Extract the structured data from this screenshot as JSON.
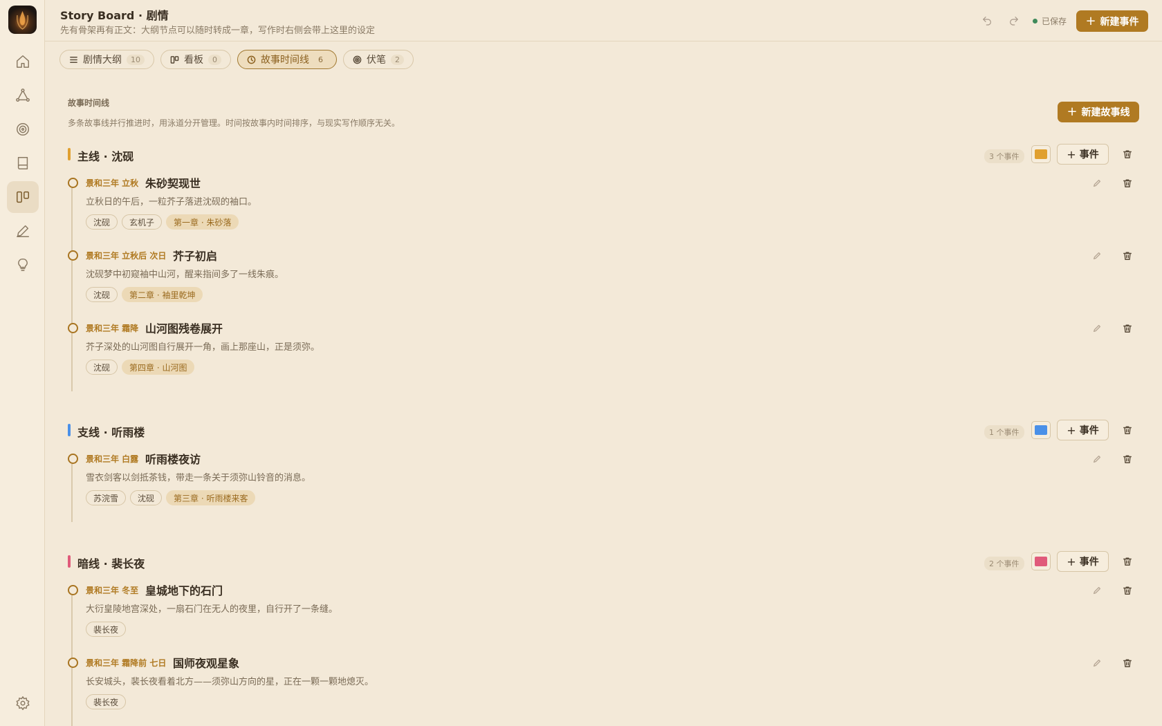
{
  "header": {
    "title": "Story Board · 剧情",
    "subtitle": "先有骨架再有正文：大纲节点可以随时转成一章，写作时右侧会带上这里的设定",
    "save_status": "已保存",
    "new_event_label": "新建事件"
  },
  "sidebar": {
    "items": [
      {
        "name": "home-icon"
      },
      {
        "name": "graph-icon"
      },
      {
        "name": "target-icon"
      },
      {
        "name": "book-icon"
      },
      {
        "name": "board-icon",
        "active": true
      },
      {
        "name": "pen-icon"
      },
      {
        "name": "bulb-icon"
      }
    ]
  },
  "tabs": [
    {
      "label": "剧情大纲",
      "count": "10"
    },
    {
      "label": "看板",
      "count": "0"
    },
    {
      "label": "故事时间线",
      "count": "6",
      "active": true
    },
    {
      "label": "伏笔",
      "count": "2"
    }
  ],
  "section": {
    "label": "故事时间线",
    "desc": "多条故事线并行推进时，用泳道分开管理。时间按故事内时间排序，与现实写作顺序无关。",
    "new_storyline_label": "新建故事线"
  },
  "lanes": [
    {
      "title": "主线 · 沈砚",
      "count": "3 个事件",
      "color": "#e0a030",
      "add_label": "事件",
      "events": [
        {
          "date": "景和三年 立秋",
          "title": "朱砂契现世",
          "desc": "立秋日的午后，一粒芥子落进沈砚的袖口。",
          "tags": [
            "沈砚",
            "玄机子"
          ],
          "chapter": "第一章 · 朱砂落"
        },
        {
          "date": "景和三年 立秋后 次日",
          "title": "芥子初启",
          "desc": "沈砚梦中初窥袖中山河，醒来指间多了一线朱痕。",
          "tags": [
            "沈砚"
          ],
          "chapter": "第二章 · 袖里乾坤"
        },
        {
          "date": "景和三年 霜降",
          "title": "山河图残卷展开",
          "desc": "芥子深处的山河图自行展开一角，画上那座山，正是须弥。",
          "tags": [
            "沈砚"
          ],
          "chapter": "第四章 · 山河图"
        }
      ]
    },
    {
      "title": "支线 · 听雨楼",
      "count": "1 个事件",
      "color": "#4a90e8",
      "add_label": "事件",
      "events": [
        {
          "date": "景和三年 白露",
          "title": "听雨楼夜访",
          "desc": "雪衣剑客以剑抵茶钱，带走一条关于须弥山铃音的消息。",
          "tags": [
            "苏浣雪",
            "沈砚"
          ],
          "chapter": "第三章 · 听雨楼来客"
        }
      ]
    },
    {
      "title": "暗线 · 裴长夜",
      "count": "2 个事件",
      "color": "#e05a7a",
      "add_label": "事件",
      "events": [
        {
          "date": "景和三年 冬至",
          "title": "皇城地下的石门",
          "desc": "大衍皇陵地宫深处，一扇石门在无人的夜里，自行开了一条缝。",
          "tags": [
            "裴长夜"
          ],
          "chapter": ""
        },
        {
          "date": "景和三年 霜降前 七日",
          "title": "国师夜观星象",
          "desc": "长安城头，裴长夜看着北方——须弥山方向的星，正在一颗一颗地熄灭。",
          "tags": [
            "裴长夜"
          ],
          "chapter": ""
        }
      ]
    }
  ]
}
